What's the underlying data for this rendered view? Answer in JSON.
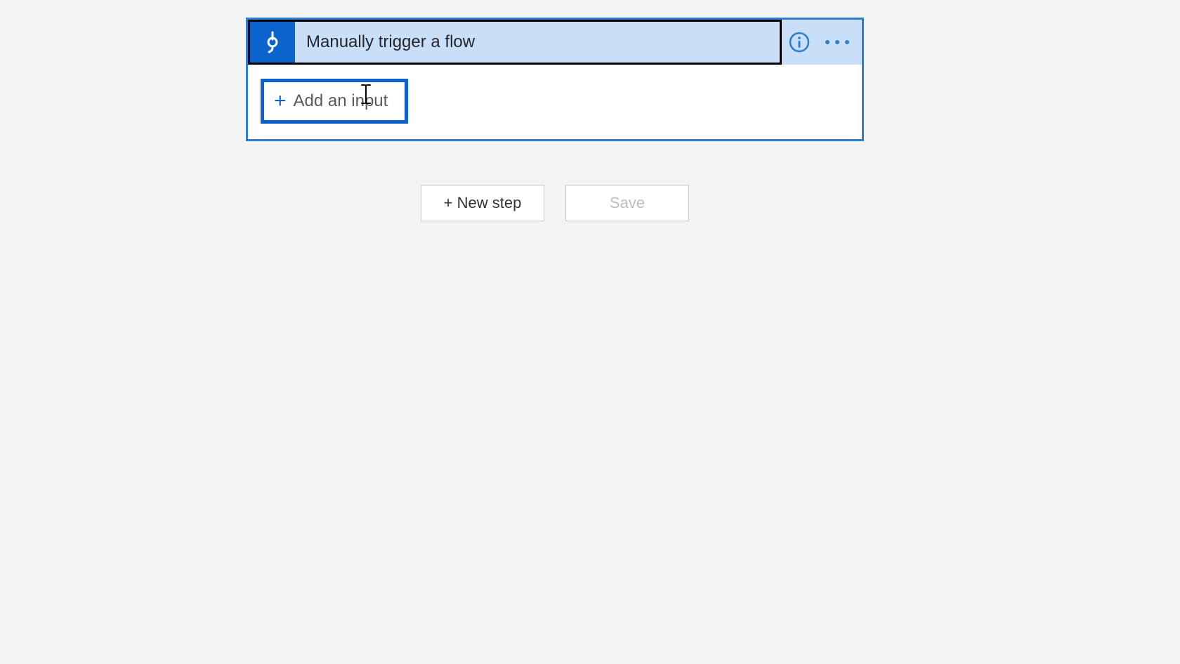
{
  "trigger": {
    "title": "Manually trigger a flow",
    "add_input_label": "Add an input"
  },
  "actions": {
    "new_step": "+ New step",
    "save": "Save"
  }
}
